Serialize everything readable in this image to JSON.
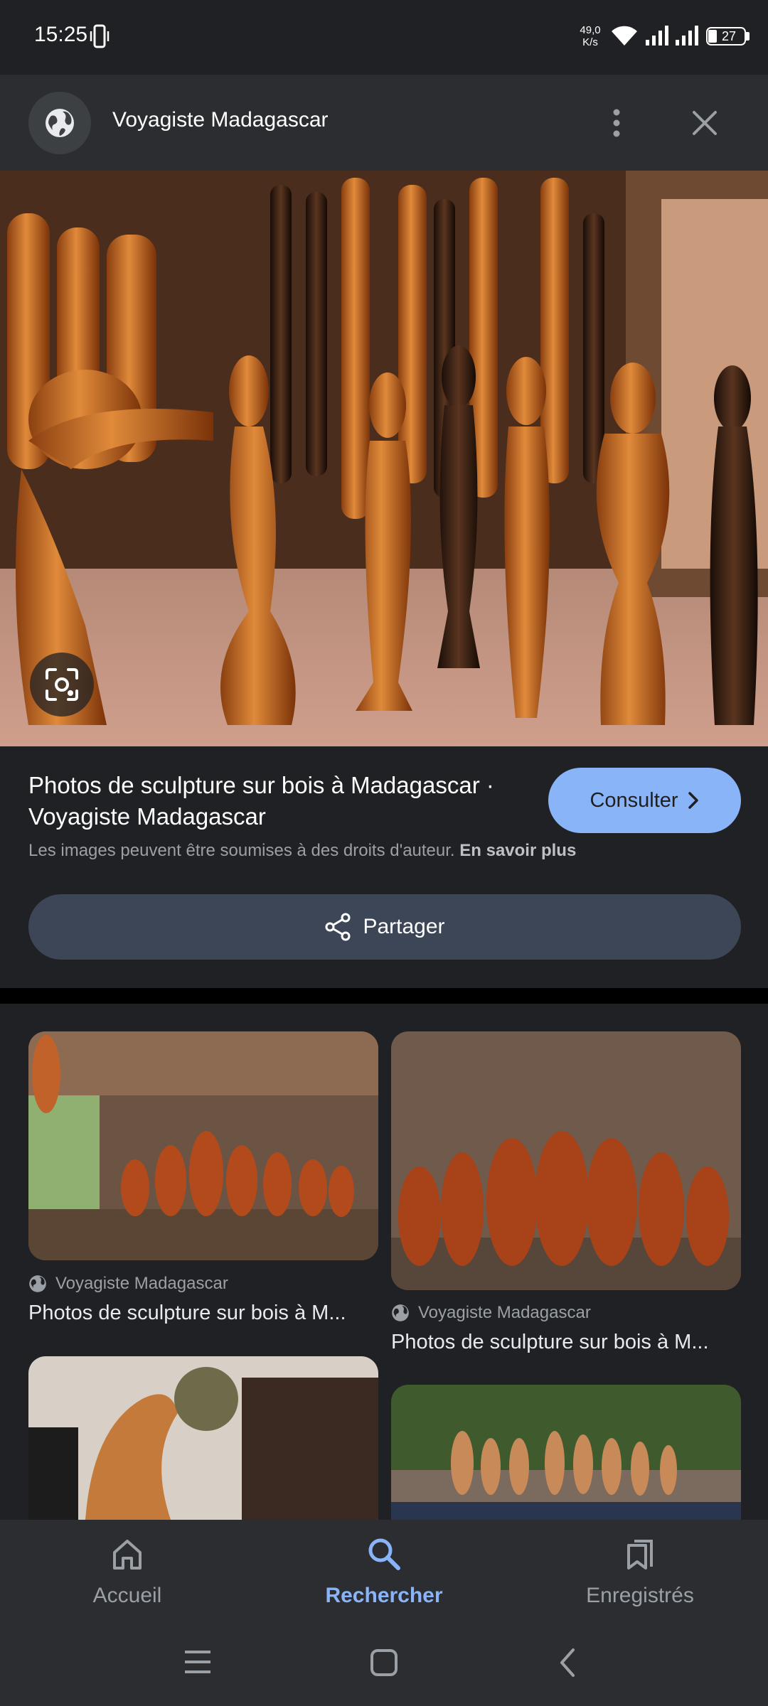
{
  "status_bar": {
    "time": "15:25",
    "net_speed_value": "49,0",
    "net_speed_unit": "K/s",
    "battery": "27"
  },
  "header": {
    "site_name": "Voyagiste Madagascar",
    "icons": [
      "globe-icon",
      "more-vert-icon",
      "close-icon"
    ]
  },
  "result": {
    "title": "Photos de sculpture sur bois à Madagascar · Voyagiste Madagascar",
    "consult_label": "Consulter",
    "copyright_text": "Les images peuvent être soumises à des droits d'auteur.",
    "learn_more": "En savoir plus",
    "share_label": "Partager"
  },
  "related": [
    {
      "source": "Voyagiste Madagascar",
      "title": "Photos de sculpture sur bois à M..."
    },
    {
      "source": "Voyagiste Madagascar",
      "title": "Photos de sculpture sur bois à M..."
    }
  ],
  "bottom_nav": {
    "items": [
      {
        "label": "Accueil",
        "icon": "home-icon"
      },
      {
        "label": "Rechercher",
        "icon": "search-icon",
        "active": true
      },
      {
        "label": "Enregistrés",
        "icon": "bookmarks-icon"
      }
    ]
  },
  "colors": {
    "background": "#202124",
    "accent": "#8ab4f8",
    "share_button": "#3c4656"
  }
}
